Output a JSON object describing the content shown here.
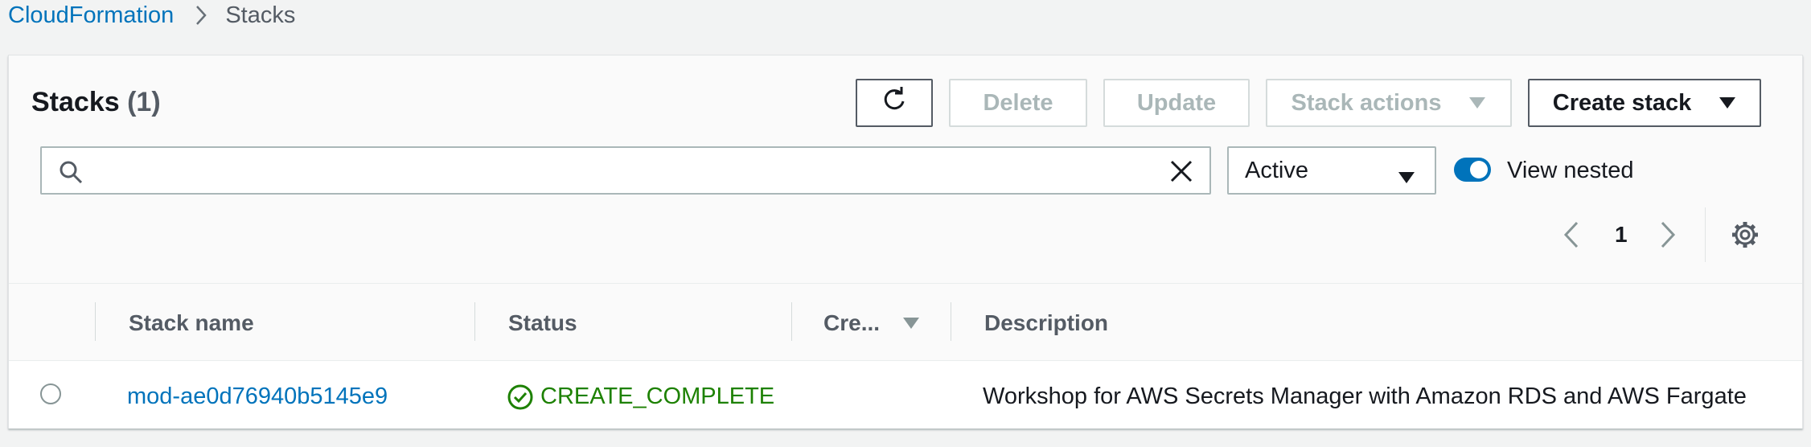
{
  "breadcrumb": {
    "root": "CloudFormation",
    "current": "Stacks"
  },
  "header": {
    "title": "Stacks",
    "count": "(1)"
  },
  "toolbar": {
    "refresh_icon": "refresh-icon",
    "delete_label": "Delete",
    "update_label": "Update",
    "stack_actions_label": "Stack actions",
    "create_stack_label": "Create stack"
  },
  "search": {
    "value": "",
    "placeholder": ""
  },
  "filter": {
    "selected": "Active"
  },
  "view_nested": {
    "label": "View nested",
    "enabled": true
  },
  "pagination": {
    "page": "1"
  },
  "table": {
    "columns": [
      "Stack name",
      "Status",
      "Cre...",
      "Description"
    ],
    "rows": [
      {
        "stack_name": "mod-ae0d76940b5145e9",
        "status": "CREATE_COMPLETE",
        "created": "",
        "description": "Workshop for AWS Secrets Manager with Amazon RDS and AWS Fargate"
      }
    ]
  },
  "colors": {
    "link": "#0073bb",
    "success": "#1d8102",
    "disabled": "#aab7b8",
    "toggle_on": "#0073bb"
  }
}
